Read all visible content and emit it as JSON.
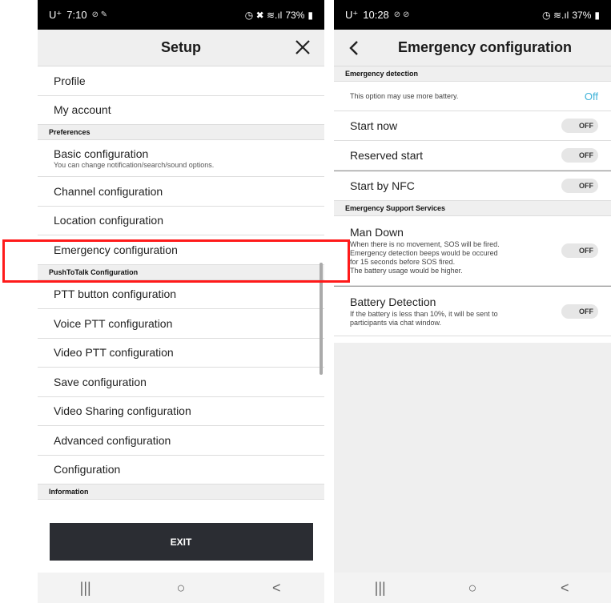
{
  "left": {
    "status": {
      "carrier": "U⁺",
      "time": "7:10",
      "extra": "⊘ ✎",
      "icons": "◷ ✖ ≋.ıl",
      "battery": "73%"
    },
    "title": "Setup",
    "close_icon": "close-icon",
    "rows": {
      "profile": "Profile",
      "my_account": "My account",
      "sec_preferences": "Preferences",
      "basic_config": "Basic configuration",
      "basic_config_sub": "You can change notification/search/sound options.",
      "channel_config": "Channel configuration",
      "location_config": "Location configuration",
      "emergency_config": "Emergency configuration",
      "sec_ptt": "PushToTalk Configuration",
      "ptt_button": "PTT button configuration",
      "voice_ptt": "Voice PTT configuration",
      "video_ptt": "Video PTT configuration",
      "save_config": "Save configuration",
      "video_sharing": "Video Sharing configuration",
      "advanced": "Advanced configuration",
      "configuration": "Configuration",
      "sec_information": "Information"
    },
    "exit_label": "EXIT",
    "nav": {
      "recent": "|||",
      "home": "○",
      "back": "<"
    }
  },
  "right": {
    "status": {
      "carrier": "U⁺",
      "time": "10:28",
      "extra": "⊘ ⊘",
      "icons": "◷ ≋.ıl",
      "battery": "37%"
    },
    "title": "Emergency configuration",
    "sec_detection": "Emergency detection",
    "battery_note": "This option may use more battery.",
    "battery_note_value": "Off",
    "start_now": "Start now",
    "reserved_start": "Reserved start",
    "start_nfc": "Start by NFC",
    "sec_support": "Emergency Support Services",
    "man_down": "Man Down",
    "man_down_desc_1": "When there is no movement, SOS will be fired.",
    "man_down_desc_2": "Emergency detection beeps would be occured",
    "man_down_desc_3": "for 15 seconds before SOS fired.",
    "man_down_desc_4": "The battery usage would be higher.",
    "battery_detection": "Battery Detection",
    "battery_detection_desc_1": "If the battery is less than 10%, it will be sent to",
    "battery_detection_desc_2": "participants via chat window.",
    "toggle_off": "OFF",
    "nav": {
      "recent": "|||",
      "home": "○",
      "back": "<"
    }
  },
  "colors": {
    "highlight": "#ff1a1a",
    "link": "#3fb2d8",
    "exit_bg": "#2b2d33"
  }
}
